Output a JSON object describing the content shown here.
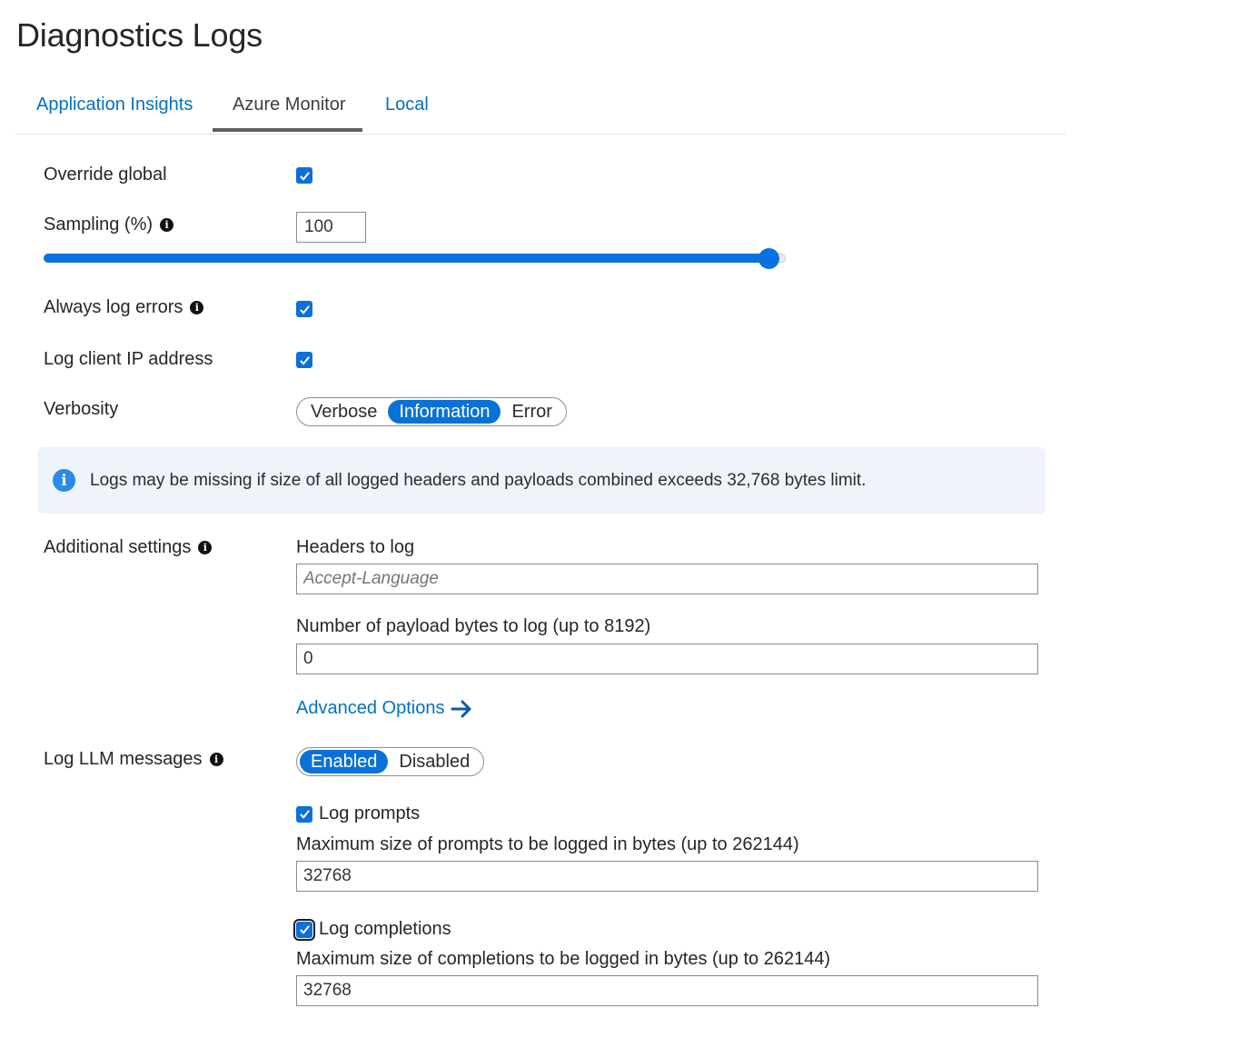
{
  "title": "Diagnostics Logs",
  "tabs": [
    {
      "label": "Application Insights",
      "active": false
    },
    {
      "label": "Azure Monitor",
      "active": true
    },
    {
      "label": "Local",
      "active": false
    }
  ],
  "settings": {
    "override_global": {
      "label": "Override global",
      "checked": true
    },
    "sampling": {
      "label": "Sampling (%)",
      "value": "100",
      "slider_percent": 100
    },
    "always_log_errors": {
      "label": "Always log errors",
      "checked": true
    },
    "log_client_ip": {
      "label": "Log client IP address",
      "checked": true
    },
    "verbosity": {
      "label": "Verbosity",
      "options": [
        "Verbose",
        "Information",
        "Error"
      ],
      "selected": "Information"
    }
  },
  "banner": {
    "icon": "info-icon",
    "text": "Logs may be missing if size of all logged headers and payloads combined exceeds 32,768 bytes limit."
  },
  "additional": {
    "label": "Additional settings",
    "headers_label": "Headers to log",
    "headers_placeholder": "Accept-Language",
    "payload_label": "Number of payload bytes to log (up to 8192)",
    "payload_value": "0",
    "advanced_link": "Advanced Options"
  },
  "llm": {
    "label": "Log LLM messages",
    "options": [
      "Enabled",
      "Disabled"
    ],
    "selected": "Enabled",
    "log_prompts": {
      "label": "Log prompts",
      "checked": true
    },
    "prompts_max_label": "Maximum size of prompts to be logged in bytes (up to 262144)",
    "prompts_max_value": "32768",
    "log_completions": {
      "label": "Log completions",
      "checked": true
    },
    "completions_max_label": "Maximum size of completions to be logged in bytes (up to 262144)",
    "completions_max_value": "32768"
  },
  "colors": {
    "accent": "#0a72e0",
    "link": "#0071c5",
    "banner_bg": "#eff4fb"
  }
}
